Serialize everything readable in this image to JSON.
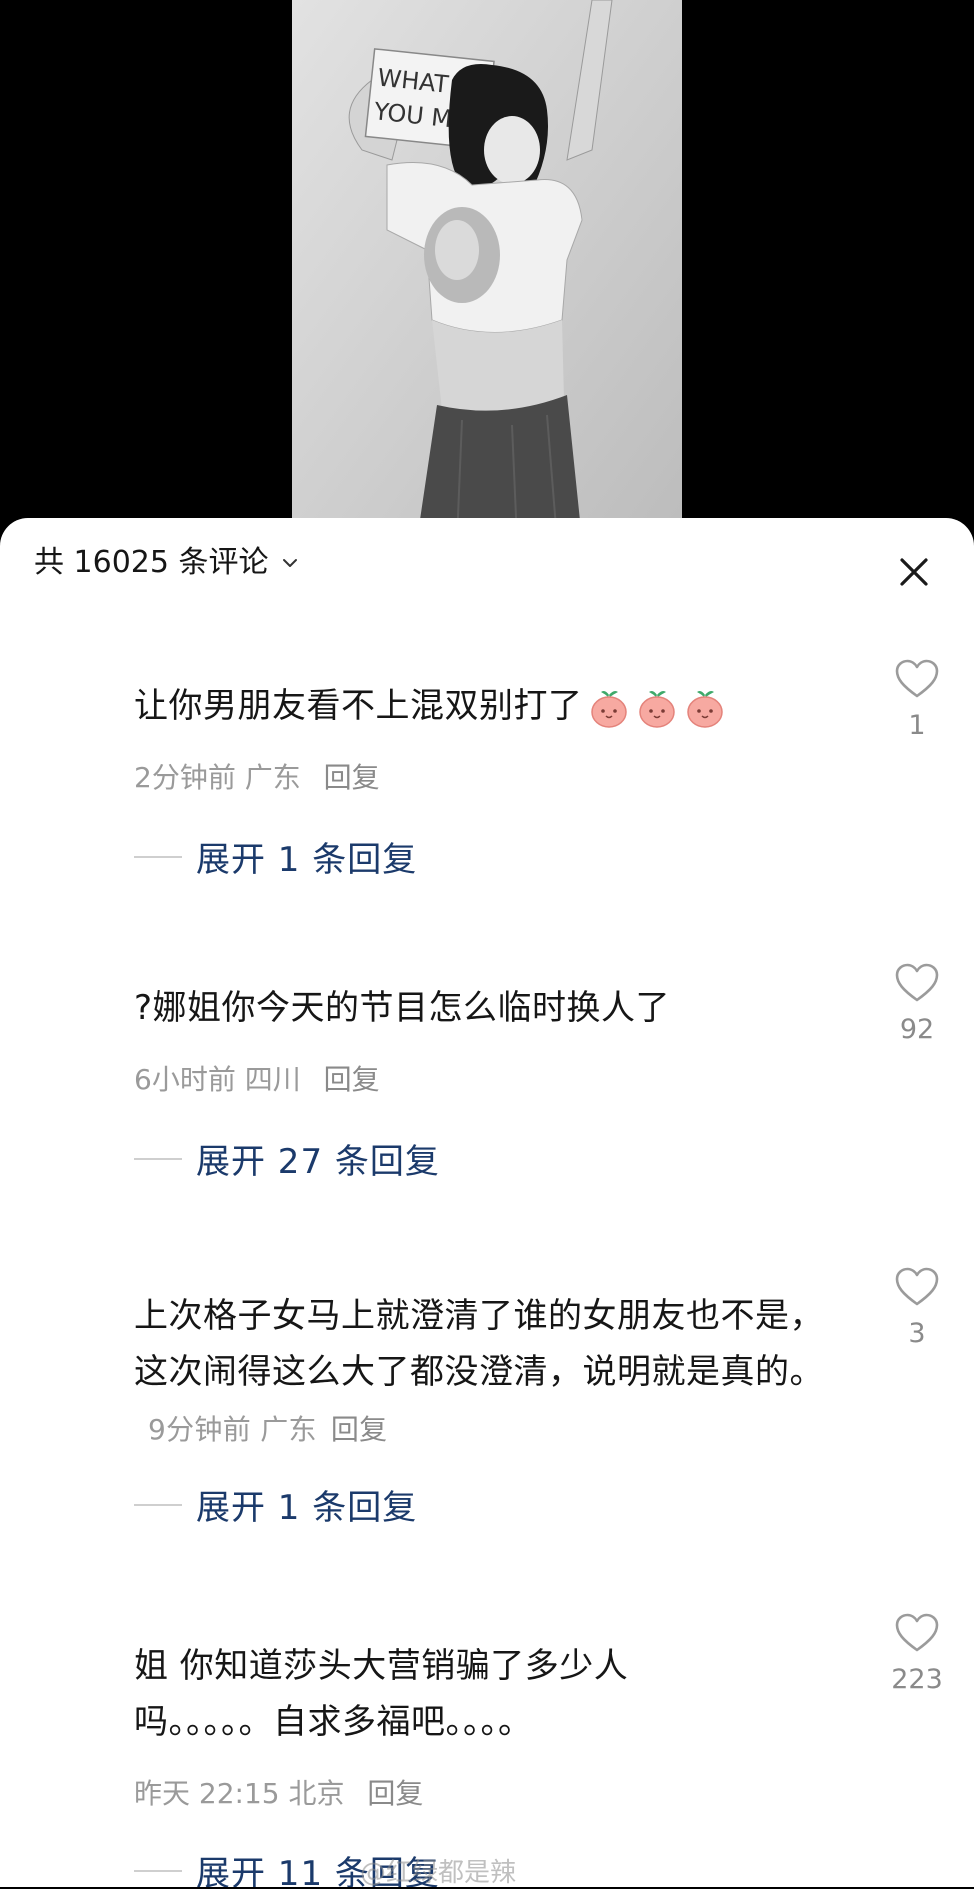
{
  "header": {
    "comment_count_label": "共 16025 条评论"
  },
  "comments": [
    {
      "text": "让你男朋友看不上混双别打了",
      "time": "2分钟前",
      "location": "广东",
      "reply_label": "回复",
      "expand_label": "展开 1 条回复",
      "likes": "1",
      "emoji_count": 3
    },
    {
      "text": "?娜姐你今天的节目怎么临时换人了",
      "time": "6小时前",
      "location": "四川",
      "reply_label": "回复",
      "expand_label": "展开 27 条回复",
      "likes": "92"
    },
    {
      "text": "上次格子女马上就澄清了谁的女朋友也不是，这次闹得这么大了都没澄清，说明就是真的。",
      "time": "9分钟前",
      "location": "广东",
      "reply_label": "回复",
      "expand_label": "展开 1 条回复",
      "likes": "3"
    },
    {
      "text_line1": "姐 你知道莎头大营销骗了多少人",
      "text_line2": "吗。。。。。自求多福吧。。。。",
      "time": "昨天 22:15",
      "location": "北京",
      "reply_label": "回复",
      "expand_label": "展开 11 条回复",
      "likes": "223"
    }
  ],
  "photo": {
    "sign_line1": "WHAT Do",
    "sign_line2": "YOU MEA"
  },
  "watermark": "@红绿都是辣",
  "colors": {
    "expand_blue": "#1b3a6b",
    "meta_gray": "#9a9a9a",
    "panel_bg": "#ffffff",
    "top_bg": "#000000"
  }
}
